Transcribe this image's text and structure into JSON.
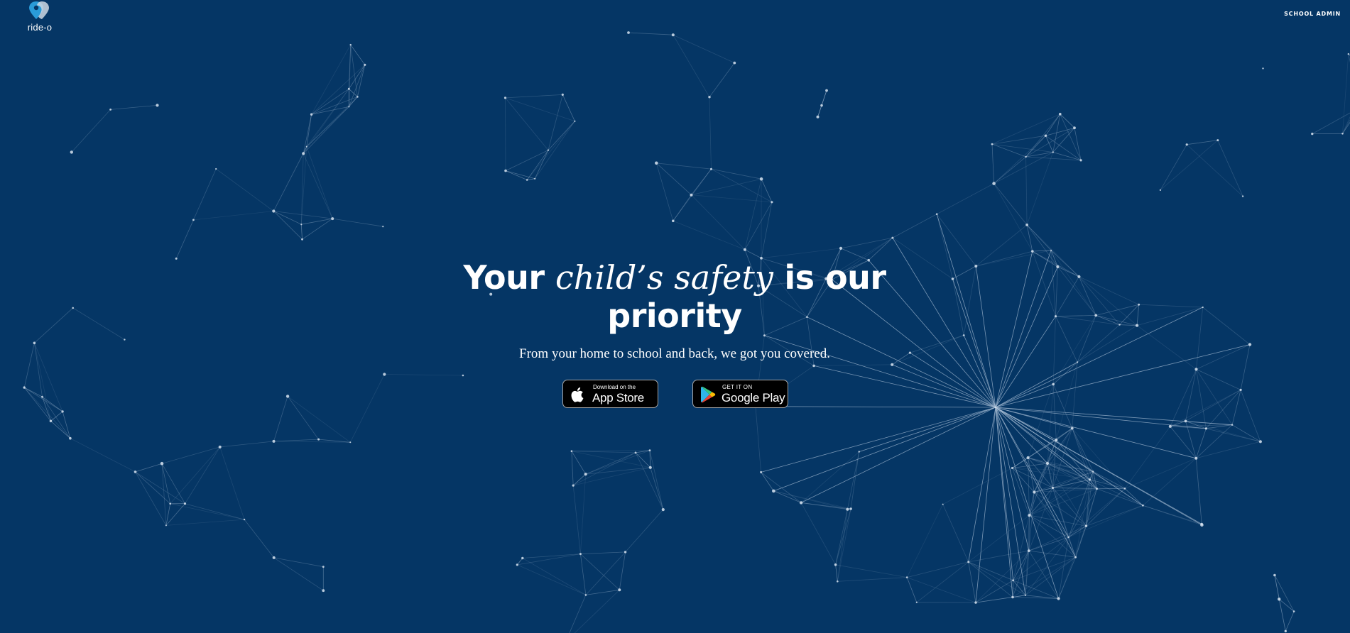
{
  "header": {
    "logo_text": "ride-o",
    "nav_link": "SCHOOL ADMIN"
  },
  "hero": {
    "headline_part1": "Your",
    "headline_italic": "child’s safety",
    "headline_part2": "is our",
    "headline_part3": "priority",
    "subheadline": "From your home to school and back, we got you covered."
  },
  "stores": {
    "apple": {
      "small": "Download on the",
      "big": "App Store",
      "icon": "apple-icon"
    },
    "google": {
      "small": "GET IT ON",
      "big": "Google Play",
      "icon": "google-play-icon"
    }
  },
  "colors": {
    "background": "#053665",
    "network_lines": "#9fb6cf",
    "logo_accent": "#2a9bd8",
    "text": "#ffffff"
  }
}
